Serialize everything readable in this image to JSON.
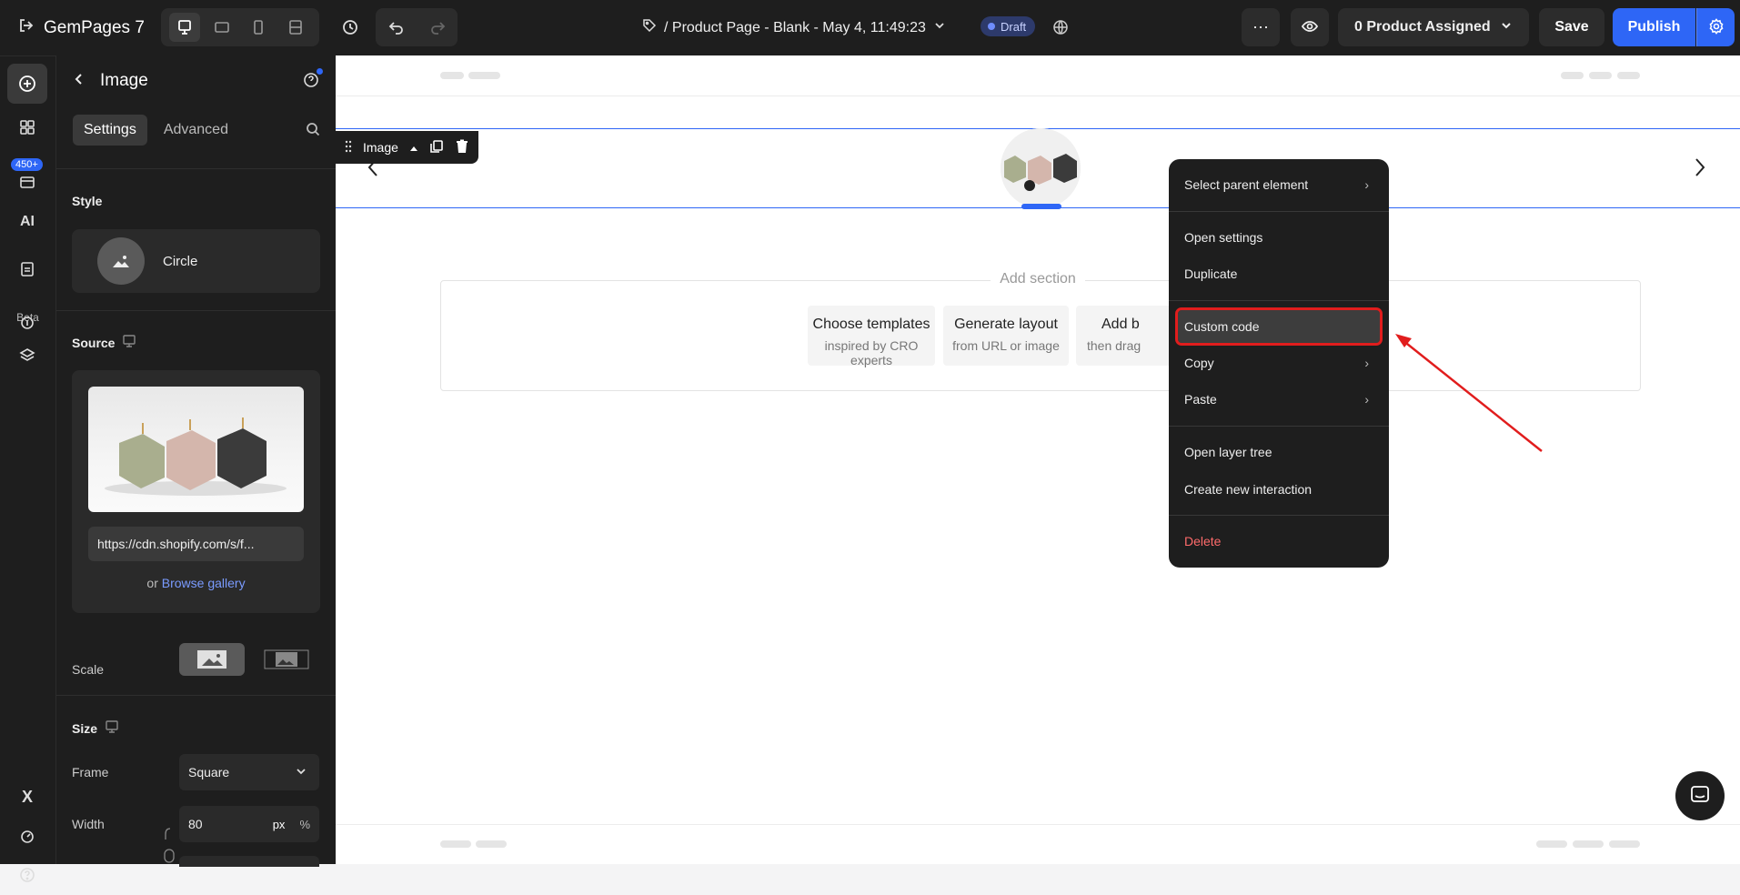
{
  "topbar": {
    "brand": "GemPages 7",
    "page_title": "/ Product Page - Blank - May 4, 11:49:23",
    "status_badge": "Draft",
    "assign_label": "0 Product Assigned",
    "save_label": "Save",
    "publish_label": "Publish"
  },
  "rail": {
    "badge_count": "450+",
    "beta_label": "Beta"
  },
  "panel": {
    "title": "Image",
    "tabs": [
      "Settings",
      "Advanced"
    ],
    "active_tab": "Settings",
    "style": {
      "title": "Style",
      "value": "Circle"
    },
    "source": {
      "title": "Source",
      "url": "https://cdn.shopify.com/s/f...",
      "or_text": "or",
      "browse_label": "Browse gallery"
    },
    "scale_label": "Scale",
    "size": {
      "title": "Size"
    },
    "frame": {
      "label": "Frame",
      "value": "Square"
    },
    "width": {
      "label": "Width",
      "value": "80",
      "unit_px": "px",
      "unit_pct": "%"
    }
  },
  "canvas": {
    "selected_tag": "Image",
    "add_section": "Add section",
    "options": [
      {
        "title": "Choose templates",
        "subtitle": "inspired by CRO experts"
      },
      {
        "title": "Generate layout",
        "subtitle": "from URL or image"
      },
      {
        "title": "Add b",
        "subtitle": "then drag"
      }
    ]
  },
  "context_menu": {
    "items": [
      "Select parent element",
      "Open settings",
      "Duplicate",
      "Custom code",
      "Copy",
      "Paste",
      "Open layer tree",
      "Create new interaction",
      "Delete"
    ],
    "highlighted": "Custom code"
  },
  "colors": {
    "accent": "#2e66f6",
    "highlight_border": "#e11d1d",
    "delete_text": "#ff6b6b",
    "dark_bg": "#1e1e1e"
  }
}
